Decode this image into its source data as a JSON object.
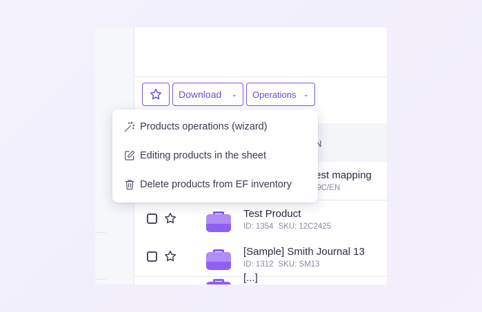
{
  "toolbar": {
    "star_icon": "star-outline-icon",
    "download_label": "Download",
    "operations_label": "Operations",
    "accent_color": "#7149dd"
  },
  "table": {
    "header_text": "IN",
    "rows": [
      {
        "name": "test mapping",
        "meta_fragment": "99C/EN"
      },
      {
        "name": "Test Product",
        "id_label": "ID: 1354",
        "sku_label": "SKU: 12C2425"
      },
      {
        "name": "[Sample] Smith Journal 13",
        "id_label": "ID: 1312",
        "sku_label": "SKU: SM13"
      },
      {
        "name": "[...]"
      }
    ]
  },
  "operations_menu": {
    "items": [
      {
        "label": "Products operations (wizard)",
        "icon": "magic-wand-icon"
      },
      {
        "label": "Editing products in the sheet",
        "icon": "edit-sheet-icon"
      },
      {
        "label": "Delete products from EF inventory",
        "icon": "trash-icon"
      }
    ]
  }
}
